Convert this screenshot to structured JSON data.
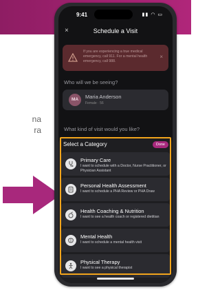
{
  "side_text": [
    "na",
    "ra"
  ],
  "status_bar": {
    "time": "9:41",
    "icons": "▮▮ ◠ ▭"
  },
  "nav": {
    "close_glyph": "×",
    "title": "Schedule a Visit"
  },
  "alert": {
    "icon": "warning-icon",
    "text": "If you are experiencing a true medical emergency, call 911. For a mental health emergency, call 988.",
    "close_glyph": "×"
  },
  "patient_section": {
    "question": "Who will we be seeing?",
    "initials": "MA",
    "name": "Maria Anderson",
    "details": "Female · 56"
  },
  "visit_question": "What kind of visit would you like?",
  "sheet": {
    "title": "Select a Category",
    "done_label": "Done",
    "categories": [
      {
        "label": "Primary Care",
        "description": "I want to schedule with a Doctor, Nurse Practitioner, or Physician Assistant",
        "icon": "stethoscope-icon"
      },
      {
        "label": "Personal Health Assessment",
        "description": "I want to schedule a PHA Review or PHA Draw",
        "icon": "clipboard-icon"
      },
      {
        "label": "Health Coaching & Nutrition",
        "description": "I want to see a health coach or registered dietitian",
        "icon": "nutrition-icon"
      },
      {
        "label": "Mental Health",
        "description": "I want to schedule a mental health visit",
        "icon": "brain-icon"
      },
      {
        "label": "Physical Therapy",
        "description": "I want to see a physical therapist",
        "icon": "physical-therapy-icon"
      }
    ]
  },
  "colors": {
    "accent": "#a8287c",
    "highlight": "#f3a51c",
    "arrow": "#a8287c"
  }
}
